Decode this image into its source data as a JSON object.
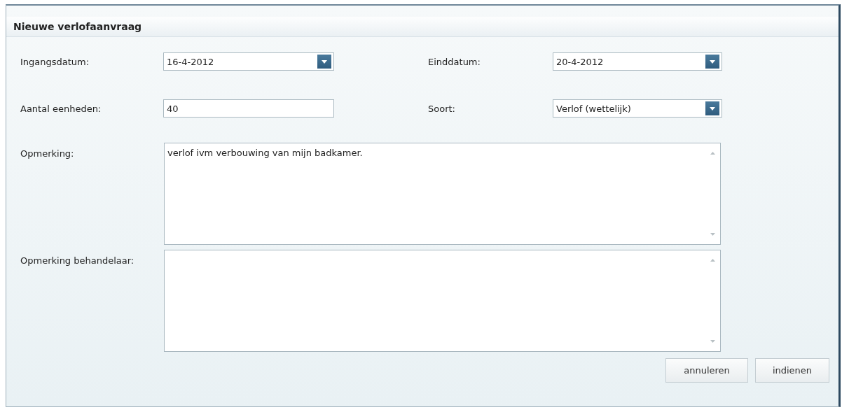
{
  "window": {
    "title": "Nieuwe verlofaanvraag"
  },
  "fields": [
    {
      "label": "Ingangsdatum:",
      "value": "16-4-2012",
      "kind": "dropdown"
    },
    {
      "label": "Einddatum:",
      "value": "20-4-2012",
      "kind": "dropdown"
    },
    {
      "label": "Aantal eenheden:",
      "value": "40",
      "kind": "text"
    },
    {
      "label": "Soort:",
      "value": "Verlof (wettelijk)",
      "kind": "dropdown"
    }
  ],
  "remarks": [
    {
      "label": "Opmerking:",
      "value": "verlof ivm verbouwing van mijn badkamer."
    },
    {
      "label": "Opmerking behandelaar:"
    }
  ],
  "buttons": [
    "annuleren",
    "indienen"
  ]
}
